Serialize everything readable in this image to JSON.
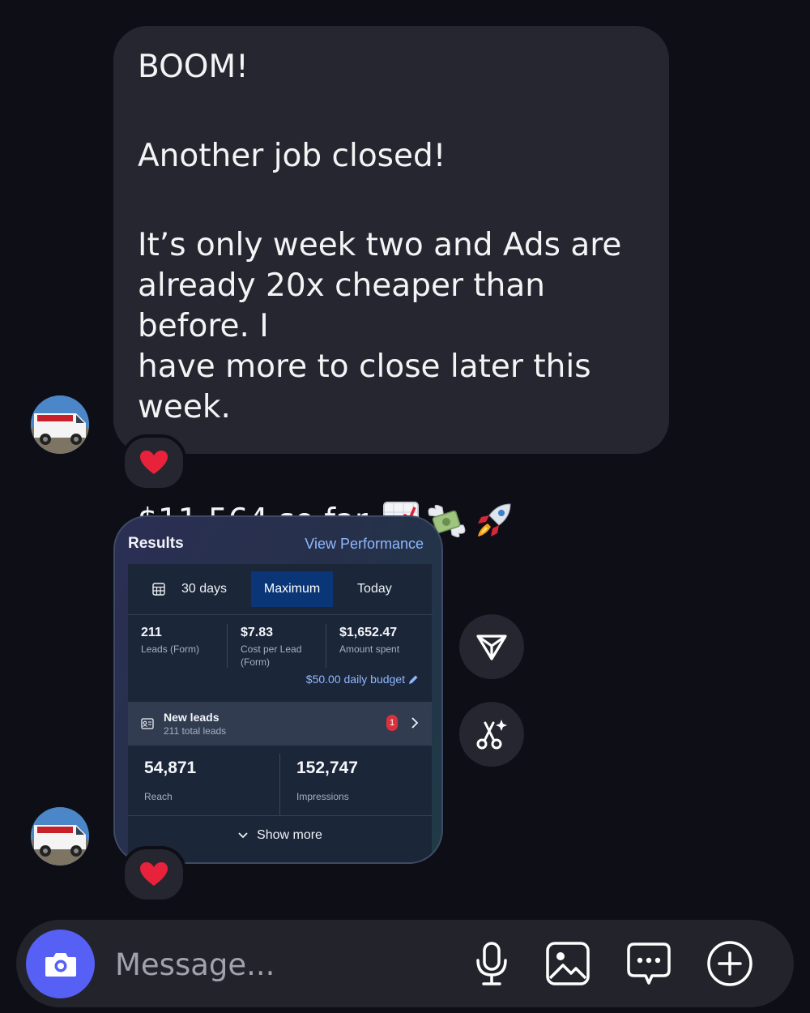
{
  "message": {
    "line1": "BOOM!",
    "line2": "Another job closed!",
    "line3a": "It’s only week two and Ads are",
    "line3b": "already 20x cheaper than before. I",
    "line3c": "have more to close later this week.",
    "line4": "$11,564 so far",
    "emojis": [
      "chart-increasing-emoji",
      "money-with-wings-emoji",
      "rocket-emoji"
    ],
    "reaction": "❤️"
  },
  "results_card": {
    "title": "Results",
    "link": "View Performance",
    "tabs": {
      "days": "30 days",
      "maximum": "Maximum",
      "today": "Today"
    },
    "metrics": [
      {
        "value": "211",
        "label": "Leads (Form)"
      },
      {
        "value": "$7.83",
        "label": "Cost per Lead (Form)"
      },
      {
        "value": "$1,652.47",
        "label": "Amount spent"
      }
    ],
    "budget": "$50.00 daily budget",
    "leads": {
      "title": "New leads",
      "subtitle": "211 total leads",
      "badge": "1"
    },
    "stats": [
      {
        "value": "54,871",
        "label": "Reach"
      },
      {
        "value": "152,747",
        "label": "Impressions"
      }
    ],
    "show_more": "Show more",
    "reaction": "❤️"
  },
  "composer": {
    "placeholder": "Message...",
    "accent": "#5660f4"
  },
  "colors": {
    "background": "#0e0e17",
    "bubble": "#262630",
    "link": "#8fb7ff",
    "heart": "#e8223a"
  }
}
